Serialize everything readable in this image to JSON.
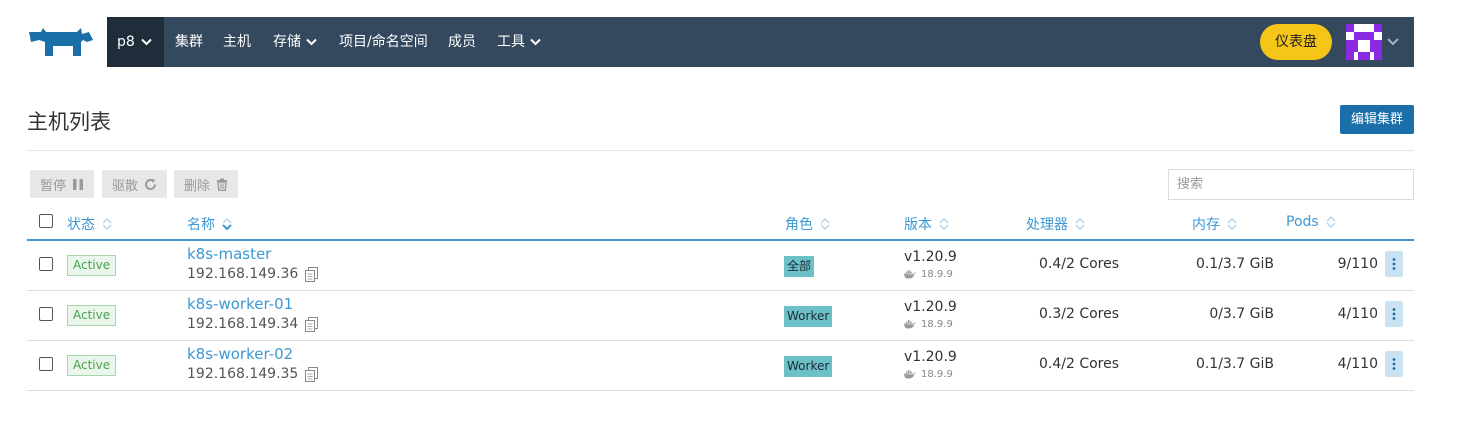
{
  "nav": {
    "cluster": "p8",
    "items": [
      {
        "label": "集群",
        "dropdown": false
      },
      {
        "label": "主机",
        "dropdown": false
      },
      {
        "label": "存储",
        "dropdown": true
      },
      {
        "label": "项目/命名空间",
        "dropdown": false
      },
      {
        "label": "成员",
        "dropdown": false
      },
      {
        "label": "工具",
        "dropdown": true
      }
    ],
    "dashboard_label": "仪表盘"
  },
  "page": {
    "title": "主机列表",
    "edit_button": "编辑集群"
  },
  "actions": {
    "pause": "暂停",
    "evict": "驱散",
    "delete": "删除",
    "search_placeholder": "搜索"
  },
  "table": {
    "columns": {
      "state": "状态",
      "name": "名称",
      "role": "角色",
      "version": "版本",
      "cpu": "处理器",
      "memory": "内存",
      "pods": "Pods"
    },
    "rows": [
      {
        "state": "Active",
        "name": "k8s-master",
        "ip": "192.168.149.36",
        "role": "全部",
        "version": "v1.20.9",
        "docker": "18.9.9",
        "cpu": "0.4/2 Cores",
        "memory": "0.1/3.7 GiB",
        "pods": "9/110"
      },
      {
        "state": "Active",
        "name": "k8s-worker-01",
        "ip": "192.168.149.34",
        "role": "Worker",
        "version": "v1.20.9",
        "docker": "18.9.9",
        "cpu": "0.3/2 Cores",
        "memory": "0/3.7 GiB",
        "pods": "4/110"
      },
      {
        "state": "Active",
        "name": "k8s-worker-02",
        "ip": "192.168.149.35",
        "role": "Worker",
        "version": "v1.20.9",
        "docker": "18.9.9",
        "cpu": "0.4/2 Cores",
        "memory": "0.1/3.7 GiB",
        "pods": "4/110"
      }
    ]
  },
  "colors": {
    "nav_bg": "#34495e",
    "accent": "#3d98d3",
    "dashboard_button": "#f5c518",
    "primary_button": "#1b6fa8",
    "active_state": "#4aa14d",
    "role_badge": "#6cc0c8"
  },
  "icons": {
    "logo": "rancher-cow-logo",
    "pause": "pause-icon",
    "evict": "refresh-icon",
    "delete": "trash-icon",
    "copy": "copy-icon",
    "docker": "docker-whale-icon",
    "row_menu": "vertical-dots-icon",
    "sort": "sort-icon"
  }
}
